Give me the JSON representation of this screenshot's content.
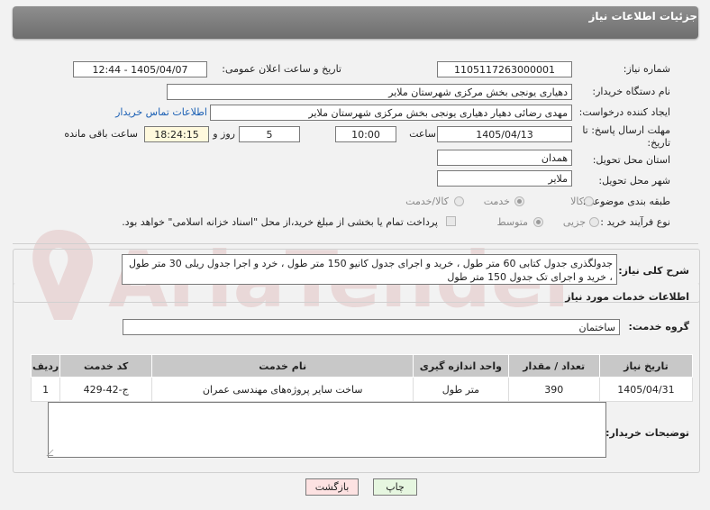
{
  "header": {
    "title": "جزئیات اطلاعات نیاز"
  },
  "form": {
    "need_number": {
      "label": "شماره نیاز:",
      "value": "1105117263000001"
    },
    "announce": {
      "label": "تاریخ و ساعت اعلان عمومی:",
      "value": "1405/04/07 - 12:44"
    },
    "buyer_org": {
      "label": "نام دستگاه خریدار:",
      "value": "دهیاری یونجی بخش مرکزی شهرستان ملایر"
    },
    "creator": {
      "label": "ایجاد کننده درخواست:",
      "value": "مهدی رضائی دهیار دهیاری یونجی بخش مرکزی شهرستان ملایر",
      "contact_link": "اطلاعات تماس خریدار"
    },
    "deadline": {
      "label_line1": "مهلت ارسال پاسخ: تا",
      "label_line2": "تاریخ:",
      "date": "1405/04/13",
      "time_label": "ساعت",
      "time": "10:00",
      "days": "5",
      "days_label": "روز و",
      "remaining": "18:24:15",
      "remaining_label": "ساعت باقی مانده"
    },
    "province": {
      "label": "استان محل تحویل:",
      "value": "همدان"
    },
    "city": {
      "label": "شهر محل تحویل:",
      "value": "ملایر"
    },
    "category": {
      "label": "طبقه بندی موضوعی:",
      "options": [
        "کالا",
        "خدمت",
        "کالا/خدمت"
      ],
      "selected": "خدمت"
    },
    "process": {
      "label": "نوع فرآیند خرید :",
      "options": [
        "جزیی",
        "متوسط"
      ],
      "selected": "متوسط",
      "payment_note": "پرداخت تمام یا بخشی از مبلغ خرید،از محل \"اسناد خزانه اسلامی\" خواهد بود."
    }
  },
  "description": {
    "label": "شرح کلی نیاز:",
    "text": "جدولگذری جدول کتابی 60 متر طول ، خرید و اجرای جدول کانیو 150 متر طول ، خرد و اجرا جدول ریلی 30 متر طول ، خرید و اجرای تک جدول 150 متر طول"
  },
  "services": {
    "title": "اطلاعات خدمات مورد نیاز",
    "group_label": "گروه خدمت:",
    "group_value": "ساختمان",
    "columns": [
      "ردیف",
      "کد خدمت",
      "نام خدمت",
      "واحد اندازه گیری",
      "تعداد / مقدار",
      "تاریخ نیاز"
    ],
    "rows": [
      [
        "1",
        "ج-42-429",
        "ساخت سایر پروژه‌های مهندسی عمران",
        "متر طول",
        "390",
        "1405/04/31"
      ]
    ]
  },
  "buyer_notes": {
    "label": "توضیحات خریدار:"
  },
  "buttons": {
    "print": "چاپ",
    "back": "بازگشت"
  },
  "watermark": {
    "text": "AriaTender.net"
  },
  "colors": {
    "header_bg": "#7d7d7d",
    "link": "#1a5fb4",
    "back_button_bg": "#fde2e2",
    "print_button_bg": "#e6f6e0"
  }
}
